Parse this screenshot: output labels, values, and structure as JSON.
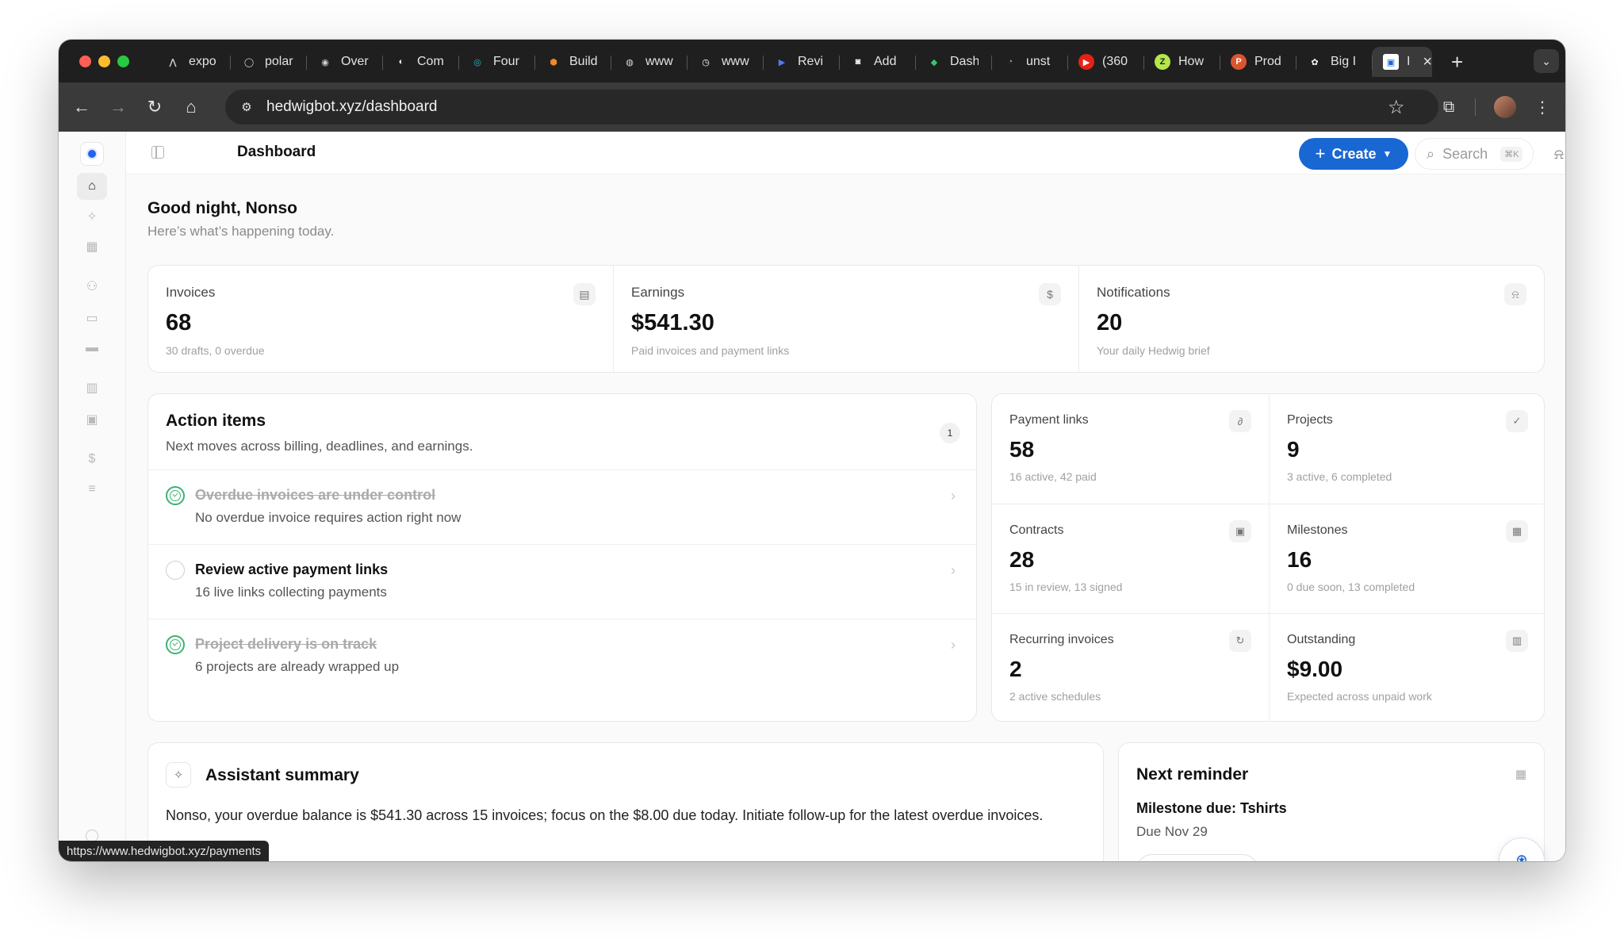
{
  "browser": {
    "tabs": [
      {
        "title": "expo",
        "fav": "⋀",
        "fav_bg": "#1f1f1f",
        "fav_fg": "#cfcfcf"
      },
      {
        "title": "polar",
        "fav": "◯",
        "fav_bg": "#1f1f1f",
        "fav_fg": "#cfcfcf"
      },
      {
        "title": "Over",
        "fav": "◉",
        "fav_bg": "#1f1f1f",
        "fav_fg": "#cfcfcf"
      },
      {
        "title": "Com",
        "fav": "◐",
        "fav_bg": "#1f1f1f",
        "fav_fg": "#ffffff"
      },
      {
        "title": "Four",
        "fav": "◎",
        "fav_bg": "#1f1f1f",
        "fav_fg": "#22b8d4"
      },
      {
        "title": "Build",
        "fav": "⬢",
        "fav_bg": "#1f1f1f",
        "fav_fg": "#f08a24"
      },
      {
        "title": "www",
        "fav": "◍",
        "fav_bg": "#1f1f1f",
        "fav_fg": "#d8d8d8"
      },
      {
        "title": "www",
        "fav": "◷",
        "fav_bg": "#1f1f1f",
        "fav_fg": "#ffffff"
      },
      {
        "title": "Revi",
        "fav": "▶",
        "fav_bg": "#1f1f1f",
        "fav_fg": "#4f7df0"
      },
      {
        "title": "Add",
        "fav": "◙",
        "fav_bg": "#1f1f1f",
        "fav_fg": "#ffffff"
      },
      {
        "title": "Dash",
        "fav": "◆",
        "fav_bg": "#1f1f1f",
        "fav_fg": "#3bc46b"
      },
      {
        "title": "unst",
        "fav": "◔",
        "fav_bg": "#1f1f1f",
        "fav_fg": "#9a9a9a"
      },
      {
        "title": "(360",
        "fav": "▶",
        "fav_bg": "#e62117",
        "fav_fg": "#ffffff"
      },
      {
        "title": "How",
        "fav": "Z",
        "fav_bg": "#b5e64a",
        "fav_fg": "#1f1f1f"
      },
      {
        "title": "Prod",
        "fav": "P",
        "fav_bg": "#da552f",
        "fav_fg": "#ffffff"
      },
      {
        "title": "Big I",
        "fav": "✿",
        "fav_bg": "#1f1f1f",
        "fav_fg": "#ffffff"
      }
    ],
    "active_tab": {
      "title": "I",
      "fav": "▣"
    },
    "new_tab": "+",
    "tab_menu": "⌄",
    "url": "hedwigbot.xyz/dashboard",
    "status_url": "https://www.hedwigbot.xyz/payments"
  },
  "header": {
    "title": "Dashboard",
    "create_label": "Create",
    "search_placeholder": "Search",
    "search_shortcut": "⌘K"
  },
  "greeting": {
    "title": "Good night, Nonso",
    "subtitle": "Here’s what’s happening today."
  },
  "stats": [
    {
      "label": "Invoices",
      "value": "68",
      "sub": "30 drafts, 0 overdue",
      "icon": "document-icon",
      "glyph": "▤"
    },
    {
      "label": "Earnings",
      "value": "$541.30",
      "sub": "Paid invoices and payment links",
      "icon": "dollar-icon",
      "glyph": "$"
    },
    {
      "label": "Notifications",
      "value": "20",
      "sub": "Your daily Hedwig brief",
      "icon": "bell-icon",
      "glyph": "⍾"
    }
  ],
  "action_items": {
    "title": "Action items",
    "subtitle": "Next moves across billing, deadlines, and earnings.",
    "count": "1",
    "items": [
      {
        "title": "Overdue invoices are under control",
        "sub": "No overdue invoice requires action right now",
        "done": true
      },
      {
        "title": "Review active payment links",
        "sub": "16 live links collecting payments",
        "done": false
      },
      {
        "title": "Project delivery is on track",
        "sub": "6 projects are already wrapped up",
        "done": true
      }
    ]
  },
  "metrics": [
    {
      "label": "Payment links",
      "value": "58",
      "sub": "16 active, 42 paid",
      "icon": "link-icon",
      "glyph": "∂"
    },
    {
      "label": "Projects",
      "value": "9",
      "sub": "3 active, 6 completed",
      "icon": "check-circle-icon",
      "glyph": "✓"
    },
    {
      "label": "Contracts",
      "value": "28",
      "sub": "15 in review, 13 signed",
      "icon": "clipboard-icon",
      "glyph": "▣"
    },
    {
      "label": "Milestones",
      "value": "16",
      "sub": "0 due soon, 13 completed",
      "icon": "calendar-icon",
      "glyph": "▦"
    },
    {
      "label": "Recurring invoices",
      "value": "2",
      "sub": "2 active schedules",
      "icon": "refresh-icon",
      "glyph": "↻"
    },
    {
      "label": "Outstanding",
      "value": "$9.00",
      "sub": "Expected across unpaid work",
      "icon": "chart-icon",
      "glyph": "▥"
    }
  ],
  "assistant": {
    "title": "Assistant summary",
    "text": "Nonso, your overdue balance is $541.30 across 15 invoices; focus on the $8.00 due today. Initiate follow-up for the latest overdue invoices."
  },
  "reminder": {
    "title": "Next reminder",
    "item": "Milestone due: Tshirts",
    "due": "Due Nov 29"
  }
}
